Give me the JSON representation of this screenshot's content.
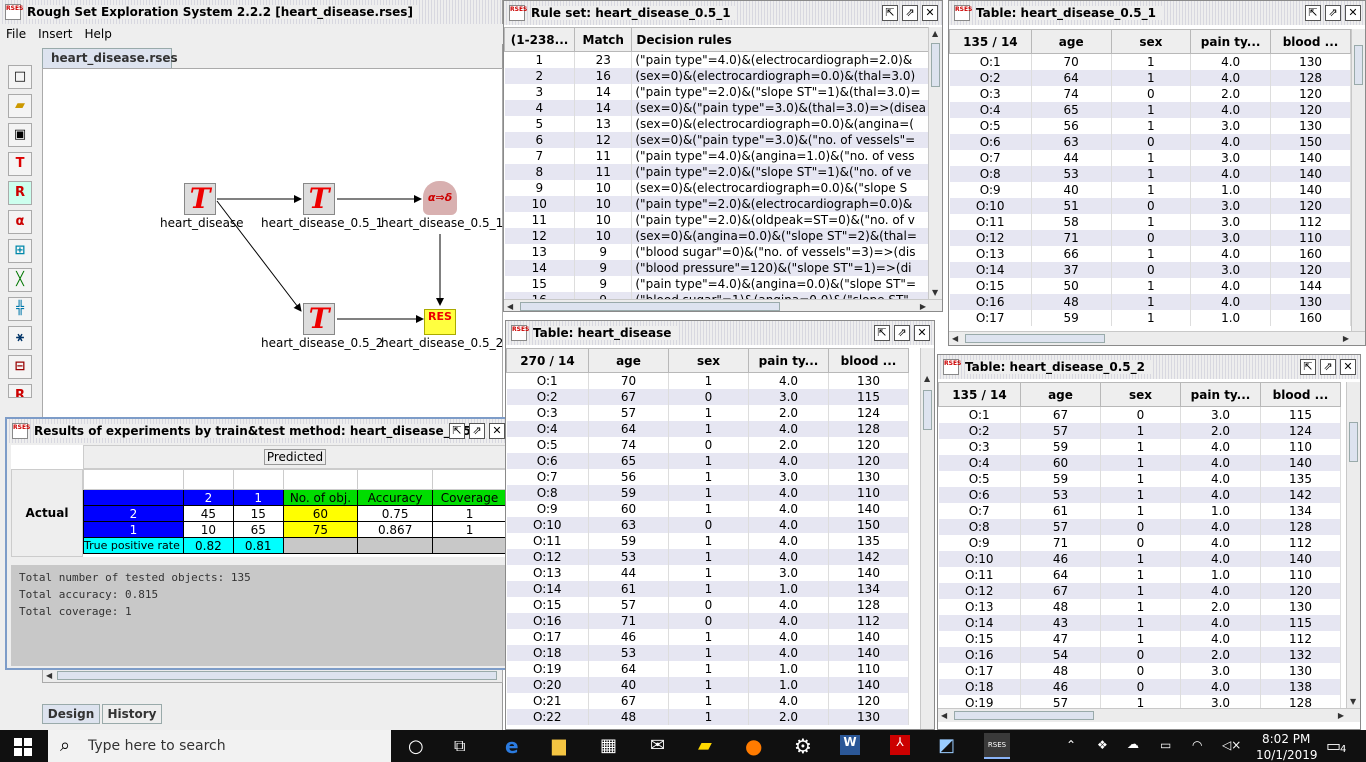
{
  "app": {
    "title": "Rough Set Exploration System 2.2.2 [heart_disease.rses]",
    "menu": [
      "File",
      "Insert",
      "Help"
    ],
    "project_tab": "heart_disease.rses",
    "bottom_tabs": [
      "Design",
      "History"
    ]
  },
  "diagram": {
    "nodes": {
      "heart_disease": "heart_disease",
      "t051": "heart_disease_0.5_1",
      "rules051": "heart_disease_0.5_1",
      "t052": "heart_disease_0.5_2",
      "res052": "heart_disease_0.5_2"
    },
    "rules_glyph": "α⇒δ",
    "res_glyph": "RES"
  },
  "ruleset": {
    "title": "Rule set: heart_disease_0.5_1",
    "headers": [
      "(1-238...",
      "Match",
      "Decision rules"
    ],
    "rows": [
      [
        "1",
        "23",
        "(\"pain type\"=4.0)&(electrocardiograph=2.0)&"
      ],
      [
        "2",
        "16",
        "(sex=0)&(electrocardiograph=0.0)&(thal=3.0)"
      ],
      [
        "3",
        "14",
        "(\"pain type\"=2.0)&(\"slope ST\"=1)&(thal=3.0)="
      ],
      [
        "4",
        "14",
        "(sex=0)&(\"pain type\"=3.0)&(thal=3.0)=>(disea"
      ],
      [
        "5",
        "13",
        "(sex=0)&(electrocardiograph=0.0)&(angina=("
      ],
      [
        "6",
        "12",
        "(sex=0)&(\"pain type\"=3.0)&(\"no. of vessels\"="
      ],
      [
        "7",
        "11",
        "(\"pain type\"=4.0)&(angina=1.0)&(\"no. of vess"
      ],
      [
        "8",
        "11",
        "(\"pain type\"=2.0)&(\"slope ST\"=1)&(\"no. of ve"
      ],
      [
        "9",
        "10",
        "(sex=0)&(electrocardiograph=0.0)&(\"slope S"
      ],
      [
        "10",
        "10",
        "(\"pain type\"=2.0)&(electrocardiograph=0.0)&"
      ],
      [
        "11",
        "10",
        "(\"pain type\"=2.0)&(oldpeak=ST=0)&(\"no. of v"
      ],
      [
        "12",
        "10",
        "(sex=0)&(angina=0.0)&(\"slope ST\"=2)&(thal="
      ],
      [
        "13",
        "9",
        "(\"blood sugar\"=0)&(\"no. of vessels\"=3)=>(dis"
      ],
      [
        "14",
        "9",
        "(\"blood pressure\"=120)&(\"slope ST\"=1)=>(di"
      ],
      [
        "15",
        "9",
        "(\"pain type\"=4.0)&(angina=0.0)&(\"slope ST\"="
      ],
      [
        "16",
        "9",
        "(\"blood sugar\"=1)&(angina=0.0)&(\"slope ST\""
      ]
    ]
  },
  "table051": {
    "title": "Table: heart_disease_0.5_1",
    "headers": [
      "135 / 14",
      "age",
      "sex",
      "pain ty...",
      "blood ..."
    ],
    "rows": [
      [
        "O:1",
        "70",
        "1",
        "4.0",
        "130"
      ],
      [
        "O:2",
        "64",
        "1",
        "4.0",
        "128"
      ],
      [
        "O:3",
        "74",
        "0",
        "2.0",
        "120"
      ],
      [
        "O:4",
        "65",
        "1",
        "4.0",
        "120"
      ],
      [
        "O:5",
        "56",
        "1",
        "3.0",
        "130"
      ],
      [
        "O:6",
        "63",
        "0",
        "4.0",
        "150"
      ],
      [
        "O:7",
        "44",
        "1",
        "3.0",
        "140"
      ],
      [
        "O:8",
        "53",
        "1",
        "4.0",
        "140"
      ],
      [
        "O:9",
        "40",
        "1",
        "1.0",
        "140"
      ],
      [
        "O:10",
        "51",
        "0",
        "3.0",
        "120"
      ],
      [
        "O:11",
        "58",
        "1",
        "3.0",
        "112"
      ],
      [
        "O:12",
        "71",
        "0",
        "3.0",
        "110"
      ],
      [
        "O:13",
        "66",
        "1",
        "4.0",
        "160"
      ],
      [
        "O:14",
        "37",
        "0",
        "3.0",
        "120"
      ],
      [
        "O:15",
        "50",
        "1",
        "4.0",
        "144"
      ],
      [
        "O:16",
        "48",
        "1",
        "4.0",
        "130"
      ],
      [
        "O:17",
        "59",
        "1",
        "1.0",
        "160"
      ]
    ]
  },
  "table_hd": {
    "title": "Table: heart_disease",
    "headers": [
      "270 / 14",
      "age",
      "sex",
      "pain ty...",
      "blood ..."
    ],
    "rows": [
      [
        "O:1",
        "70",
        "1",
        "4.0",
        "130"
      ],
      [
        "O:2",
        "67",
        "0",
        "3.0",
        "115"
      ],
      [
        "O:3",
        "57",
        "1",
        "2.0",
        "124"
      ],
      [
        "O:4",
        "64",
        "1",
        "4.0",
        "128"
      ],
      [
        "O:5",
        "74",
        "0",
        "2.0",
        "120"
      ],
      [
        "O:6",
        "65",
        "1",
        "4.0",
        "120"
      ],
      [
        "O:7",
        "56",
        "1",
        "3.0",
        "130"
      ],
      [
        "O:8",
        "59",
        "1",
        "4.0",
        "110"
      ],
      [
        "O:9",
        "60",
        "1",
        "4.0",
        "140"
      ],
      [
        "O:10",
        "63",
        "0",
        "4.0",
        "150"
      ],
      [
        "O:11",
        "59",
        "1",
        "4.0",
        "135"
      ],
      [
        "O:12",
        "53",
        "1",
        "4.0",
        "142"
      ],
      [
        "O:13",
        "44",
        "1",
        "3.0",
        "140"
      ],
      [
        "O:14",
        "61",
        "1",
        "1.0",
        "134"
      ],
      [
        "O:15",
        "57",
        "0",
        "4.0",
        "128"
      ],
      [
        "O:16",
        "71",
        "0",
        "4.0",
        "112"
      ],
      [
        "O:17",
        "46",
        "1",
        "4.0",
        "140"
      ],
      [
        "O:18",
        "53",
        "1",
        "4.0",
        "140"
      ],
      [
        "O:19",
        "64",
        "1",
        "1.0",
        "110"
      ],
      [
        "O:20",
        "40",
        "1",
        "1.0",
        "140"
      ],
      [
        "O:21",
        "67",
        "1",
        "4.0",
        "120"
      ],
      [
        "O:22",
        "48",
        "1",
        "2.0",
        "130"
      ]
    ]
  },
  "table052": {
    "title": "Table: heart_disease_0.5_2",
    "headers": [
      "135 / 14",
      "age",
      "sex",
      "pain ty...",
      "blood ..."
    ],
    "rows": [
      [
        "O:1",
        "67",
        "0",
        "3.0",
        "115"
      ],
      [
        "O:2",
        "57",
        "1",
        "2.0",
        "124"
      ],
      [
        "O:3",
        "59",
        "1",
        "4.0",
        "110"
      ],
      [
        "O:4",
        "60",
        "1",
        "4.0",
        "140"
      ],
      [
        "O:5",
        "59",
        "1",
        "4.0",
        "135"
      ],
      [
        "O:6",
        "53",
        "1",
        "4.0",
        "142"
      ],
      [
        "O:7",
        "61",
        "1",
        "1.0",
        "134"
      ],
      [
        "O:8",
        "57",
        "0",
        "4.0",
        "128"
      ],
      [
        "O:9",
        "71",
        "0",
        "4.0",
        "112"
      ],
      [
        "O:10",
        "46",
        "1",
        "4.0",
        "140"
      ],
      [
        "O:11",
        "64",
        "1",
        "1.0",
        "110"
      ],
      [
        "O:12",
        "67",
        "1",
        "4.0",
        "120"
      ],
      [
        "O:13",
        "48",
        "1",
        "2.0",
        "130"
      ],
      [
        "O:14",
        "43",
        "1",
        "4.0",
        "115"
      ],
      [
        "O:15",
        "47",
        "1",
        "4.0",
        "112"
      ],
      [
        "O:16",
        "54",
        "0",
        "2.0",
        "132"
      ],
      [
        "O:17",
        "48",
        "0",
        "3.0",
        "130"
      ],
      [
        "O:18",
        "46",
        "0",
        "4.0",
        "138"
      ],
      [
        "O:19",
        "57",
        "1",
        "3.0",
        "128"
      ]
    ]
  },
  "results": {
    "title": "Results of experiments by train&test method: heart_disease_0.5_2",
    "predicted": "Predicted",
    "actual": "Actual",
    "col_headers": [
      "2",
      "1",
      "No. of obj.",
      "Accuracy",
      "Coverage"
    ],
    "rows": [
      {
        "label": "2",
        "cells": [
          "45",
          "15",
          "60",
          "0.75",
          "1"
        ]
      },
      {
        "label": "1",
        "cells": [
          "10",
          "65",
          "75",
          "0.867",
          "1"
        ]
      }
    ],
    "tpr_label": "True positive rate",
    "tpr": [
      "0.82",
      "0.81"
    ],
    "summary": [
      "Total number of tested objects: 135",
      "Total accuracy: 0.815",
      "Total coverage: 1"
    ],
    "colors": {
      "blue": "#0000ff",
      "yellow": "#ffff00",
      "green": "#00dd00",
      "cyan": "#00ffff"
    }
  },
  "taskbar": {
    "search_placeholder": "Type here to search",
    "time": "8:02 PM",
    "date": "10/1/2019",
    "notifications": "4"
  }
}
